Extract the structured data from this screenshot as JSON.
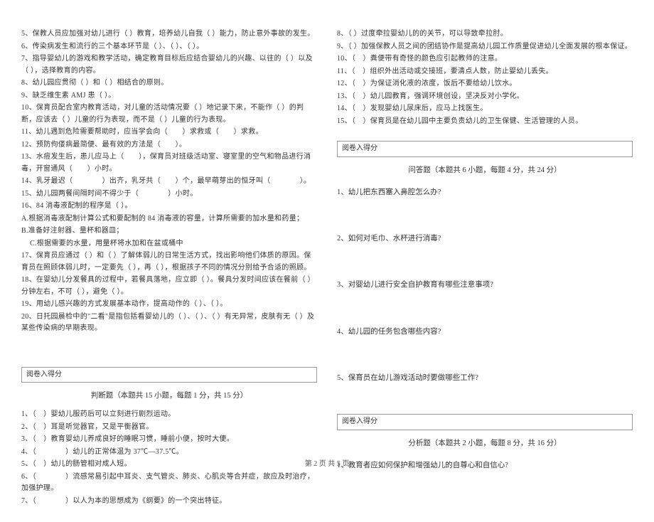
{
  "left": {
    "q5": "5、保教人员应加强对幼儿进行（ ）教育，培养幼儿自我（ ）能力，防止意外事故的发生。",
    "q6": "6、传染病发生和流行的三个基本环节是（ ）、（ ）、（ ）。",
    "q7": "7、指导婴幼儿的游戏和教学活动，确定教育目标后应结合婴幼儿的兴趣、以往的（ ）以及（ ），选择教育的内容。",
    "q8": "8、幼儿园应贯彻（ ）和（ ）相结合的原则。",
    "q9": "9、缺乏维生素 AMJ 患（ ）。",
    "q10": "10、保育员配合室内教育活动，对儿童的活动情况要（ ）地记录下来，不能作（ ）的判断，应该去（ ）儿童的行为表现，而不是（ ）儿童的行为表现。",
    "q11": "11、幼儿遇到危险需要帮助时，应当学会向（　　）求救或（　　）求救。",
    "q12": "12、预防佝偻病最简便、最有效的方法是（　　）。",
    "q13": "13、水痘发生后，患儿应马上（　　），保育员对班级活动室、寝室里的空气和物品进行消毒，开窗通风（　　）小时。",
    "q14": "14、乳牙最迟（　　　　）出齐，乳牙共（　　）个，最早萌芽出的恒牙叫（　　　　）。",
    "q15": "15、幼儿园两餐间隔时间不得少于（　　　　）小时。",
    "q16": "16、84 消毒液配制的程序是（ ）。",
    "q16a": "A.根据消毒液配制计算公式和要配制的 84 消毒液的容量，计算所需要的加水量和药量；",
    "q16b": "B.准备好注射器、量杯和器皿；",
    "q16c": "C.根据需要的水量，用量杯将水加和在盆或桶中",
    "q17": "17、保育员应通过（ ）和（ ）了解体弱儿的日常生活方式，找出影响他们体质的原因。保育员在照顾体弱儿时，一定要先（ ），再（ ），根据孩子不同的情况分别给予合适的照顾。",
    "q18": "18、在婴幼儿分发餐具的过程中，若餐具落地，应立即（ ）。餐具分发时间应该在餐前（ ）分钟左右，不可（ ），避免（ ）。",
    "q19": "19、用幼儿感兴趣的方式发展基本动作，提高动作的（ ）、（ ）。",
    "q20": "20、日托园晨检中的\"二看\"是指包括看婴幼儿的（ ）、（ ）、（ ）有无异常，皮肤有无（ ）及某些传染病的早期表现。",
    "boxlabel": "阅卷入得分",
    "judgetitle": "判断题（本题共 15 小题，每题 1 分，共 15 分）",
    "j1": "1、（　）婴幼儿服药后可以立刻进行剧烈运动。",
    "j2": "2、（　）耳是听觉器官，又是平衡器官。",
    "j3": "3、（　）教育婴幼儿养成良好的睡眠习惯，睡前小便，按时大便。",
    "j4": "4、（　　　　）幼儿的正常体温为 37℃—37.5℃。",
    "j5": "5、（　）幼儿的肠管相对成人短。",
    "j6": "6、（　　　　）流感常易引起中耳炎、支气管炎、肺炎、心肌炎等合并症，故应及时治疗，加强护理。",
    "j7": "7、（　　　　）以人为本的思想成为《纲要》的一个突出特征。"
  },
  "right": {
    "j8": "8、（ ）过度牵拉婴幼儿的的关节，可以导致牵拉肘。",
    "j9": "9、（ ）加强保教人员之间的团结协作是提高幼儿园工作质量促进幼儿全面发展的根本保证。",
    "j10": "10、（　）粪便带有奇怪的颜色应引起教师的注意。",
    "j11": "11、（　）组织外出活动或交接班，要清点人数，防止婴幼儿丢失。",
    "j12": "12、（　）为保证消化液的浓度，饭后不要给幼儿饮水。",
    "j13": "13、（　）幼儿园教育，强调环境创设，坚决反对小学化。",
    "j14": "14、（　）发现婴幼儿尿床后，应马上找医生。",
    "j15": "15、（　）保育员是在幼儿园中主要负责幼儿的卫生保健、生活管理的人员。",
    "boxlabel2": "阅卷入得分",
    "asktitle": "问答题（本题共 6 小题，每题 4 分，共 24 分）",
    "a1": "1、幼儿把东西塞入鼻腔怎么办?",
    "a2": "2、如何对毛巾、水杯进行消毒?",
    "a3": "3、对婴幼儿进行安全自护教育有哪些注意事项?",
    "a4": "4、幼儿园的任务包含哪些内容?",
    "a5": "5、保育员在幼儿游戏活动时要做哪些工作?",
    "boxlabel3": "阅卷入得分",
    "analysistitle": "分析题（本题共 2 小题，每题 8 分，共 16 分）",
    "an1": "1、教育者应如何保护和增强幼儿的自尊心和自信心?"
  },
  "footer": "第 2 页 共 5 页"
}
